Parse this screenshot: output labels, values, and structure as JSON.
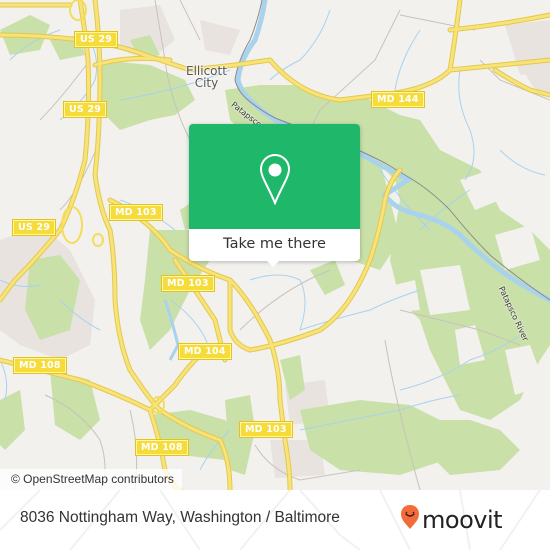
{
  "map": {
    "attribution": "© OpenStreetMap contributors",
    "places": [
      {
        "name": "Ellicott City",
        "line1": "Ellicott",
        "line2": "City"
      }
    ],
    "river_labels": [
      {
        "text": "Patapsco River"
      },
      {
        "text": "Patapsco River"
      }
    ],
    "road_shields": [
      {
        "label": "US 29"
      },
      {
        "label": "US 29"
      },
      {
        "label": "US 29"
      },
      {
        "label": "MD 144"
      },
      {
        "label": "MD 103"
      },
      {
        "label": "MD 103"
      },
      {
        "label": "MD 104"
      },
      {
        "label": "MD 108"
      },
      {
        "label": "MD 108"
      },
      {
        "label": "MD 103"
      }
    ],
    "colors": {
      "background": "#f2f1ee",
      "park": "#c8dfa6",
      "water": "#a9d3ec",
      "road": "#f5dc5a",
      "residential": "#e8e2de"
    }
  },
  "popup": {
    "icon": "map-pin-icon",
    "button_label": "Take me there",
    "color": "#1fb86a"
  },
  "footer": {
    "address": "8036 Nottingham Way, Washington / Baltimore",
    "logo_text": "moovit",
    "logo_color": "#f26b3a"
  }
}
